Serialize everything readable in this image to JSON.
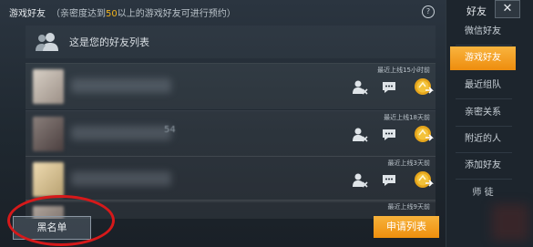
{
  "header": {
    "title": "游戏好友",
    "notice_prefix": "（亲密度达到",
    "notice_value": "50",
    "notice_suffix": "以上的游戏好友可进行预约）"
  },
  "intro": {
    "text": "这是您的好友列表"
  },
  "friends": [
    {
      "last_online": "最近上线15小时前",
      "name_suffix": ""
    },
    {
      "last_online": "最近上线18天前",
      "name_suffix": "54"
    },
    {
      "last_online": "最近上线3天前",
      "name_suffix": ""
    },
    {
      "last_online": "最近上线9天前",
      "name_suffix": ""
    }
  ],
  "buttons": {
    "blacklist": "黑名单",
    "apply_list": "申请列表"
  },
  "sidebar": {
    "title": "好友",
    "close": "✕",
    "items": [
      {
        "label": "微信好友",
        "active": false
      },
      {
        "label": "游戏好友",
        "active": true
      },
      {
        "label": "最近组队",
        "active": false
      },
      {
        "label": "亲密关系",
        "active": false
      },
      {
        "label": "附近的人",
        "active": false
      },
      {
        "label": "添加好友",
        "active": false
      },
      {
        "label": "师 徒",
        "active": false
      }
    ]
  },
  "colors": {
    "accent": "#f2b31c",
    "active_tab": "#ee8f0d",
    "annotation_red": "#d6191a"
  },
  "icons": {
    "help": "question-circle-icon",
    "friends": "people-icon",
    "remove": "remove-friend-icon",
    "chat": "chat-bubble-icon",
    "gift": "gift-coin-icon"
  }
}
